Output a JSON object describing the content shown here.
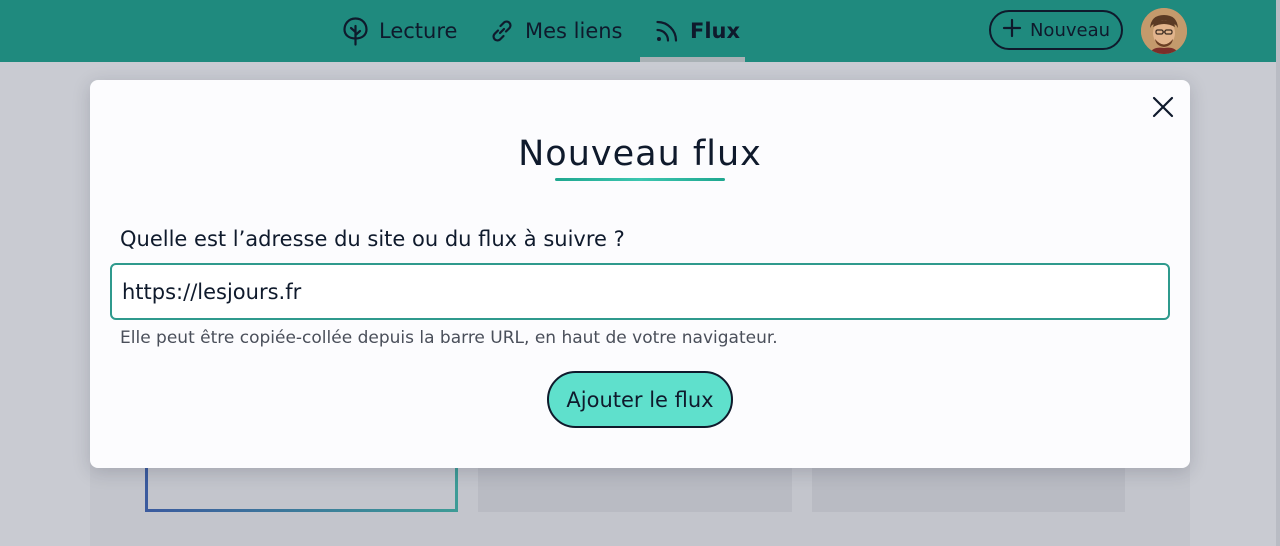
{
  "nav": {
    "items": [
      {
        "label": "Lecture",
        "icon": "tree-icon",
        "active": false
      },
      {
        "label": "Mes liens",
        "icon": "link-icon",
        "active": false
      },
      {
        "label": "Flux",
        "icon": "rss-icon",
        "active": true
      }
    ],
    "new_button_label": "Nouveau"
  },
  "modal": {
    "title": "Nouveau flux",
    "question": "Quelle est l’adresse du site ou du flux à suivre ?",
    "url_value": "https://lesjours.fr",
    "hint": "Elle peut être copiée-collée depuis la barre URL, en haut de votre navigateur.",
    "submit_label": "Ajouter le flux"
  },
  "colors": {
    "header": "#1f8a7e",
    "accent": "#5fe0cc",
    "text": "#0f1a2c"
  }
}
